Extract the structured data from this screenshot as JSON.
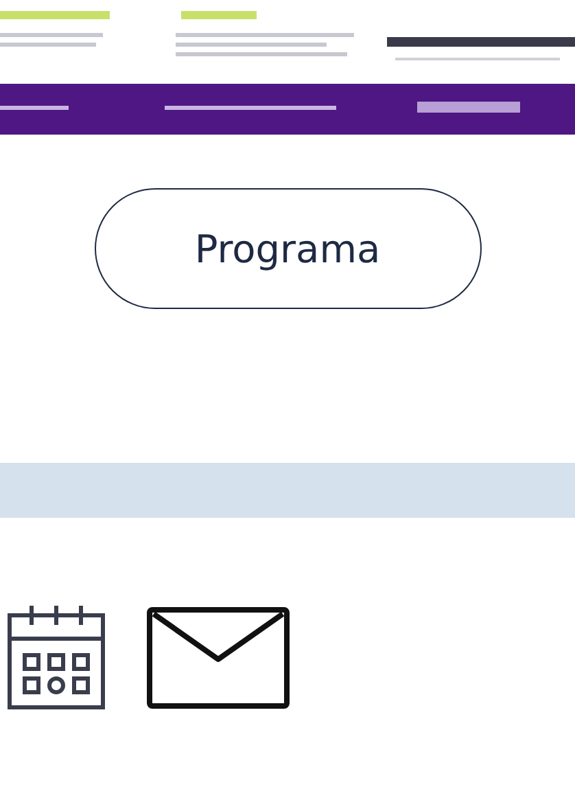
{
  "program_button": {
    "label": "Programa"
  }
}
